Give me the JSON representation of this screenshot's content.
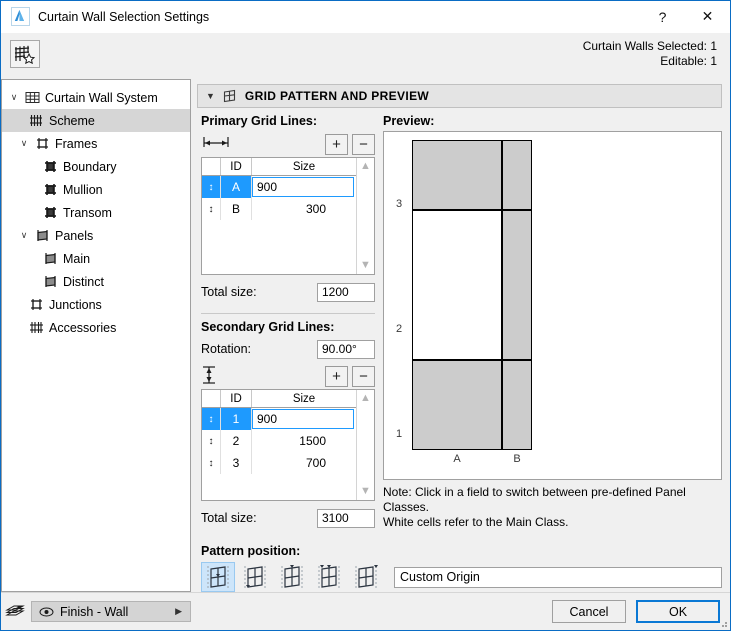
{
  "window": {
    "title": "Curtain Wall Selection Settings",
    "app_icon": "archicad-logo-icon",
    "help_label": "?",
    "close_label": "✕"
  },
  "subheader": {
    "tool_icon": "curtain-wall-scheme-icon",
    "selected_text": "Curtain Walls Selected: 1",
    "editable_text": "Editable: 1"
  },
  "sidebar": {
    "items": [
      {
        "label": "Curtain Wall System",
        "icon": "grid-system-icon",
        "indent": 0,
        "twisty": "∨",
        "selected": false
      },
      {
        "label": "Scheme",
        "icon": "scheme-icon",
        "indent": 1,
        "twisty": "",
        "selected": true
      },
      {
        "label": "Frames",
        "icon": "frames-icon",
        "indent": 1,
        "twisty": "∨",
        "selected": false
      },
      {
        "label": "Boundary",
        "icon": "boundary-icon",
        "indent": 2,
        "twisty": "",
        "selected": false
      },
      {
        "label": "Mullion",
        "icon": "mullion-icon",
        "indent": 2,
        "twisty": "",
        "selected": false
      },
      {
        "label": "Transom",
        "icon": "transom-icon",
        "indent": 2,
        "twisty": "",
        "selected": false
      },
      {
        "label": "Panels",
        "icon": "panels-icon",
        "indent": 1,
        "twisty": "∨",
        "selected": false
      },
      {
        "label": "Main",
        "icon": "panel-main-icon",
        "indent": 2,
        "twisty": "",
        "selected": false
      },
      {
        "label": "Distinct",
        "icon": "panel-distinct-icon",
        "indent": 2,
        "twisty": "",
        "selected": false
      },
      {
        "label": "Junctions",
        "icon": "junctions-icon",
        "indent": 1,
        "twisty": "",
        "selected": false
      },
      {
        "label": "Accessories",
        "icon": "accessories-icon",
        "indent": 1,
        "twisty": "",
        "selected": false
      }
    ]
  },
  "panel": {
    "caret": "▼",
    "icon": "grid-pattern-icon",
    "title": "GRID PATTERN AND PREVIEW"
  },
  "primary": {
    "label": "Primary Grid Lines:",
    "dim_icon": "horizontal-dimension-icon",
    "add_label": "+",
    "remove_label": "−",
    "columns": [
      "ID",
      "Size"
    ],
    "rows": [
      {
        "id": "A",
        "size": "900",
        "selected": true
      },
      {
        "id": "B",
        "size": "300",
        "selected": false
      }
    ],
    "total_label": "Total size:",
    "total_value": "1200"
  },
  "secondary": {
    "label": "Secondary Grid Lines:",
    "rotation_label": "Rotation:",
    "rotation_value": "90.00°",
    "dim_icon": "vertical-dimension-icon",
    "add_label": "+",
    "remove_label": "−",
    "columns": [
      "ID",
      "Size"
    ],
    "rows": [
      {
        "id": "1",
        "size": "900",
        "selected": true
      },
      {
        "id": "2",
        "size": "1500",
        "selected": false
      },
      {
        "id": "3",
        "size": "700",
        "selected": false
      }
    ],
    "total_label": "Total size:",
    "total_value": "3100"
  },
  "preview": {
    "label": "Preview:",
    "column_labels": [
      "A",
      "B"
    ],
    "row_labels": [
      "3",
      "2",
      "1"
    ],
    "column_sizes": [
      900,
      300
    ],
    "row_sizes_top_down": [
      700,
      1500,
      900
    ],
    "cells": [
      {
        "col": "A",
        "row": "3",
        "class": "distinct"
      },
      {
        "col": "B",
        "row": "3",
        "class": "distinct"
      },
      {
        "col": "A",
        "row": "2",
        "class": "main"
      },
      {
        "col": "B",
        "row": "2",
        "class": "distinct"
      },
      {
        "col": "A",
        "row": "1",
        "class": "distinct"
      },
      {
        "col": "B",
        "row": "1",
        "class": "distinct"
      }
    ],
    "note_line1": "Note: Click in a field to switch between pre-defined Panel Classes.",
    "note_line2": "White cells refer to the Main Class."
  },
  "pattern_position": {
    "label": "Pattern position:",
    "options": [
      {
        "icon": "pattern-custom-origin-icon",
        "selected": true
      },
      {
        "icon": "pattern-bottom-left-icon",
        "selected": false
      },
      {
        "icon": "pattern-top-left-icon",
        "selected": false
      },
      {
        "icon": "pattern-top-center-icon",
        "selected": false
      },
      {
        "icon": "pattern-top-right-icon",
        "selected": false
      }
    ],
    "value": "Custom Origin"
  },
  "footer": {
    "layer_icon": "layers-icon",
    "eye_icon": "eye-icon",
    "layer_value": "Finish - Wall",
    "dropdown_arrow": "▶",
    "cancel_label": "Cancel",
    "ok_label": "OK"
  },
  "colors": {
    "accent": "#1e9afe",
    "title_border": "#0a6cc4",
    "panel_bg": "#f0f0f0",
    "selection_row": "#d6d6d6",
    "cell_distinct": "#cccccc",
    "cell_main": "#ffffff",
    "pattern_selected": "#cde5fa"
  }
}
